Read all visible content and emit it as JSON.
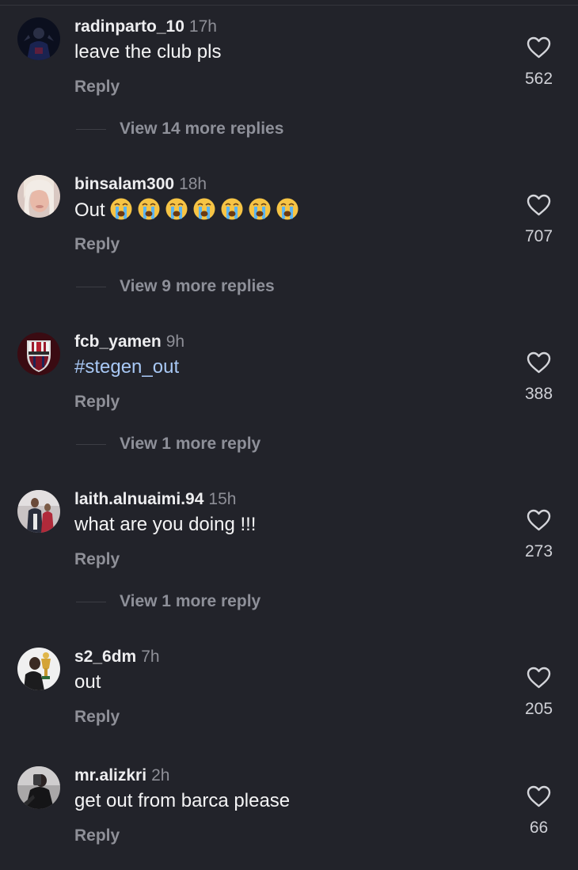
{
  "comments": [
    {
      "username": "radinparto_10",
      "time": "17h",
      "text": "leave the club pls",
      "reply_label": "Reply",
      "likes": "562",
      "view_more": "View 14 more replies",
      "avatar_icon": "player-avatar-icon"
    },
    {
      "username": "binsalam300",
      "time": "18h",
      "text": "Out",
      "emojis": [
        "loudly-crying-face",
        "loudly-crying-face",
        "loudly-crying-face",
        "loudly-crying-face",
        "loudly-crying-face",
        "loudly-crying-face",
        "loudly-crying-face"
      ],
      "reply_label": "Reply",
      "likes": "707",
      "view_more": "View 9 more replies",
      "avatar_icon": "portrait-avatar-icon"
    },
    {
      "username": "fcb_yamen",
      "time": "9h",
      "text": "#stegen_out",
      "reply_label": "Reply",
      "likes": "388",
      "view_more": "View 1 more reply",
      "avatar_icon": "crest-avatar-icon"
    },
    {
      "username": "laith.alnuaimi.94",
      "time": "15h",
      "text": "what are you doing !!!",
      "reply_label": "Reply",
      "likes": "273",
      "view_more": "View 1 more reply",
      "avatar_icon": "photo-avatar-icon"
    },
    {
      "username": "s2_6dm",
      "time": "7h",
      "text": "out",
      "reply_label": "Reply",
      "likes": "205",
      "avatar_icon": "trophy-avatar-icon"
    },
    {
      "username": "mr.alizkri",
      "time": "2h",
      "text": "get out from barca please",
      "reply_label": "Reply",
      "likes": "66",
      "avatar_icon": "selfie-avatar-icon"
    }
  ],
  "colors": {
    "background": "#22232a",
    "hashtag": "#a8c8f5",
    "muted": "#8e8f97"
  }
}
